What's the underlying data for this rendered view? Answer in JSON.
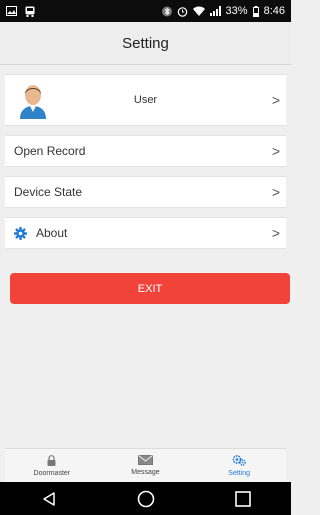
{
  "status_bar": {
    "battery": "33%",
    "time": "8:46"
  },
  "header": {
    "title": "Setting"
  },
  "settings": {
    "user_label": "User",
    "open_record_label": "Open Record",
    "device_state_label": "Device State",
    "about_label": "About",
    "chevron": ">"
  },
  "exit_button": {
    "label": "EXIT"
  },
  "tabs": [
    {
      "label": "Doormaster",
      "icon": "lock-icon"
    },
    {
      "label": "Message",
      "icon": "envelope-icon"
    },
    {
      "label": "Setting",
      "icon": "gears-icon",
      "active": true
    }
  ],
  "colors": {
    "accent": "#1f7ad6",
    "exit": "#f2433a"
  }
}
